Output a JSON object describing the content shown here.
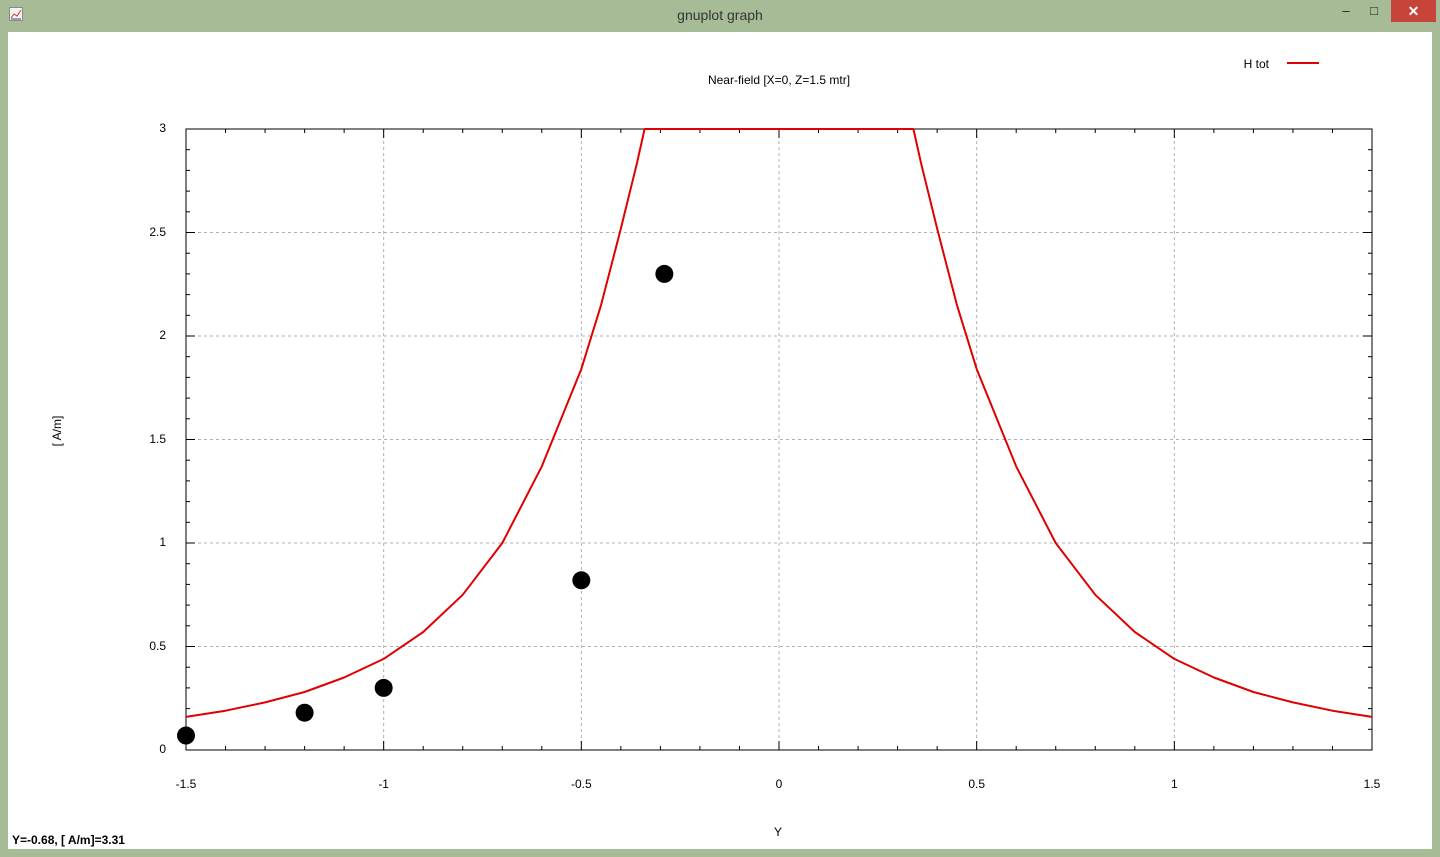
{
  "window": {
    "title": "gnuplot graph",
    "app_icon": "gnuplot-icon",
    "controls": {
      "minimize": "–",
      "maximize": "□",
      "close": "✕"
    }
  },
  "status": {
    "coordinates": "Y=-0.68, [ A/m]=3.31"
  },
  "colors": {
    "line": "#e00000",
    "points": "#000000",
    "grid": "#b0b0b0"
  },
  "chart_data": {
    "type": "line",
    "title": "Near-field [X=0, Z=1.5 mtr]",
    "xlabel": "Y",
    "ylabel": "[ A/m]",
    "xlim": [
      -1.5,
      1.5
    ],
    "ylim": [
      0,
      3
    ],
    "xticks": [
      "-1.5",
      "-1",
      "-0.5",
      "0",
      "0.5",
      "1",
      "1.5"
    ],
    "yticks": [
      "0",
      "0.5",
      "1",
      "1.5",
      "2",
      "2.5",
      "3"
    ],
    "grid": true,
    "legend_position": "top-right",
    "series": [
      {
        "name": "H tot",
        "style": "line",
        "x": [
          -1.5,
          -1.4,
          -1.3,
          -1.2,
          -1.1,
          -1.0,
          -0.9,
          -0.8,
          -0.7,
          -0.6,
          -0.5,
          -0.45,
          -0.4,
          -0.36,
          -0.34,
          0.34,
          0.36,
          0.4,
          0.45,
          0.5,
          0.6,
          0.7,
          0.8,
          0.9,
          1.0,
          1.1,
          1.2,
          1.3,
          1.4,
          1.5
        ],
        "y": [
          0.16,
          0.19,
          0.23,
          0.28,
          0.35,
          0.44,
          0.57,
          0.75,
          1.0,
          1.37,
          1.84,
          2.15,
          2.52,
          2.83,
          3.0,
          3.0,
          2.83,
          2.52,
          2.15,
          1.84,
          1.37,
          1.0,
          0.75,
          0.57,
          0.44,
          0.35,
          0.28,
          0.23,
          0.19,
          0.16
        ]
      },
      {
        "style": "points",
        "x": [
          -1.5,
          -1.2,
          -1.0,
          -0.5,
          -0.29
        ],
        "y": [
          0.07,
          0.18,
          0.3,
          0.82,
          2.3
        ]
      }
    ]
  }
}
